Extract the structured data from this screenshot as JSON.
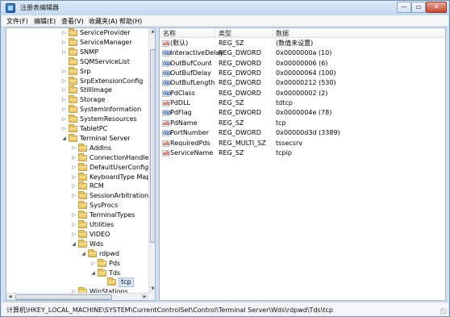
{
  "window": {
    "title": "注册表编辑器",
    "min_glyph": "—",
    "max_glyph": "▭",
    "close_glyph": "✕"
  },
  "menu": [
    "文件(F)",
    "编辑(E)",
    "查看(V)",
    "收藏夹(A)",
    "帮助(H)"
  ],
  "tree": [
    {
      "label": "ServiceProvider",
      "level": 0,
      "expander": "▷"
    },
    {
      "label": "ServiceManager",
      "level": 0,
      "expander": "▷"
    },
    {
      "label": "SNMP",
      "level": 0,
      "expander": "▷"
    },
    {
      "label": "SQMServiceList",
      "level": 0,
      "expander": ""
    },
    {
      "label": "Srp",
      "level": 0,
      "expander": "▷"
    },
    {
      "label": "SrpExtensionConfig",
      "level": 0,
      "expander": "▷"
    },
    {
      "label": "StillImage",
      "level": 0,
      "expander": "▷"
    },
    {
      "label": "Storage",
      "level": 0,
      "expander": "▷"
    },
    {
      "label": "SystemInformation",
      "level": 0,
      "expander": "▷"
    },
    {
      "label": "SystemResources",
      "level": 0,
      "expander": "▷"
    },
    {
      "label": "TabletPC",
      "level": 0,
      "expander": "▷"
    },
    {
      "label": "Terminal Server",
      "level": 0,
      "expander": "◢"
    },
    {
      "label": "AddIns",
      "level": 1,
      "expander": "▷"
    },
    {
      "label": "ConnectionHandler",
      "level": 1,
      "expander": "▷"
    },
    {
      "label": "DefaultUserConfigurati",
      "level": 1,
      "expander": "▷"
    },
    {
      "label": "KeyboardType Mappin",
      "level": 1,
      "expander": "▷"
    },
    {
      "label": "RCM",
      "level": 1,
      "expander": "▷"
    },
    {
      "label": "SessionArbitrationHelpe",
      "level": 1,
      "expander": "▷"
    },
    {
      "label": "SysProcs",
      "level": 1,
      "expander": ""
    },
    {
      "label": "TerminalTypes",
      "level": 1,
      "expander": "▷"
    },
    {
      "label": "Utilities",
      "level": 1,
      "expander": "▷"
    },
    {
      "label": "VIDEO",
      "level": 1,
      "expander": "▷"
    },
    {
      "label": "Wds",
      "level": 1,
      "expander": "◢"
    },
    {
      "label": "rdpwd",
      "level": 2,
      "expander": "◢"
    },
    {
      "label": "Pds",
      "level": 3,
      "expander": "▷"
    },
    {
      "label": "Tds",
      "level": 3,
      "expander": "◢"
    },
    {
      "label": "tcp",
      "level": 4,
      "expander": "",
      "selected": true
    },
    {
      "label": "WinStations",
      "level": 1,
      "expander": "▷"
    }
  ],
  "columns": {
    "name": "名称",
    "type": "类型",
    "data": "数据"
  },
  "values": [
    {
      "icon": "ab",
      "kind": "sz",
      "name": "(默认)",
      "type": "REG_SZ",
      "data": "(数值未设置)"
    },
    {
      "icon": "010",
      "kind": "dw",
      "name": "InteractiveDelay",
      "type": "REG_DWORD",
      "data": "0x0000000a (10)"
    },
    {
      "icon": "010",
      "kind": "dw",
      "name": "OutBufCount",
      "type": "REG_DWORD",
      "data": "0x00000006 (6)"
    },
    {
      "icon": "010",
      "kind": "dw",
      "name": "OutBufDelay",
      "type": "REG_DWORD",
      "data": "0x00000064 (100)"
    },
    {
      "icon": "010",
      "kind": "dw",
      "name": "OutBufLength",
      "type": "REG_DWORD",
      "data": "0x00000212 (530)"
    },
    {
      "icon": "010",
      "kind": "dw",
      "name": "PdClass",
      "type": "REG_DWORD",
      "data": "0x00000002 (2)"
    },
    {
      "icon": "ab",
      "kind": "sz",
      "name": "PdDLL",
      "type": "REG_SZ",
      "data": "tdtcp"
    },
    {
      "icon": "010",
      "kind": "dw",
      "name": "PdFlag",
      "type": "REG_DWORD",
      "data": "0x0000004e (78)"
    },
    {
      "icon": "ab",
      "kind": "sz",
      "name": "PdName",
      "type": "REG_SZ",
      "data": "tcp"
    },
    {
      "icon": "010",
      "kind": "dw",
      "name": "PortNumber",
      "type": "REG_DWORD",
      "data": "0x00000d3d (3389)"
    },
    {
      "icon": "ab",
      "kind": "sz",
      "name": "RequiredPds",
      "type": "REG_MULTI_SZ",
      "data": "tssecsrv"
    },
    {
      "icon": "ab",
      "kind": "sz",
      "name": "ServiceName",
      "type": "REG_SZ",
      "data": "tcpip"
    }
  ],
  "status": "计算机\\HKEY_LOCAL_MACHINE\\SYSTEM\\CurrentControlSet\\Control\\Terminal Server\\Wds\\rdpwd\\Tds\\tcp",
  "scroll": {
    "up": "▲",
    "down": "▼",
    "left": "◀",
    "right": "▶"
  }
}
